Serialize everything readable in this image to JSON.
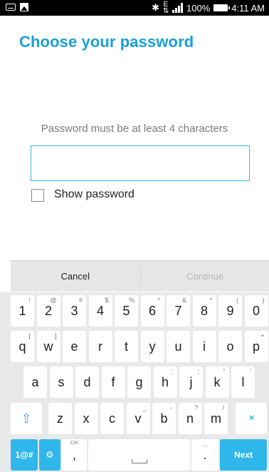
{
  "status_bar": {
    "network_type": "E",
    "battery_percent": "100%",
    "time": "4:11 AM"
  },
  "screen": {
    "title": "Choose your password",
    "hint": "Password must be at least 4 characters",
    "password_value": "",
    "show_password_label": "Show password",
    "show_password_checked": false
  },
  "actions": {
    "cancel": "Cancel",
    "continue": "Continue"
  },
  "keyboard": {
    "rows": [
      [
        {
          "label": "1",
          "secondary": "!"
        },
        {
          "label": "2",
          "secondary": "@"
        },
        {
          "label": "3",
          "secondary": "#"
        },
        {
          "label": "4",
          "secondary": "$"
        },
        {
          "label": "5",
          "secondary": "%"
        },
        {
          "label": "6",
          "secondary": "^"
        },
        {
          "label": "7",
          "secondary": "&"
        },
        {
          "label": "8",
          "secondary": "*"
        },
        {
          "label": "9",
          "secondary": "("
        },
        {
          "label": "0",
          "secondary": ")"
        }
      ],
      [
        {
          "label": "q",
          "secondary": "["
        },
        {
          "label": "w",
          "secondary": "]"
        },
        {
          "label": "e",
          "secondary": ""
        },
        {
          "label": "r",
          "secondary": ""
        },
        {
          "label": "t",
          "secondary": ""
        },
        {
          "label": "y",
          "secondary": ""
        },
        {
          "label": "u",
          "secondary": ""
        },
        {
          "label": "i",
          "secondary": ""
        },
        {
          "label": "o",
          "secondary": ""
        },
        {
          "label": "p",
          "secondary": "+"
        }
      ],
      [
        {
          "label": "a",
          "secondary": ""
        },
        {
          "label": "s",
          "secondary": ""
        },
        {
          "label": "d",
          "secondary": ""
        },
        {
          "label": "f",
          "secondary": ""
        },
        {
          "label": "g",
          "secondary": ""
        },
        {
          "label": "h",
          "secondary": ":"
        },
        {
          "label": "j",
          "secondary": ";"
        },
        {
          "label": "k",
          "secondary": "\""
        },
        {
          "label": "l",
          "secondary": "'"
        }
      ],
      [
        {
          "label": "z",
          "secondary": ""
        },
        {
          "label": "x",
          "secondary": ""
        },
        {
          "label": "c",
          "secondary": ""
        },
        {
          "label": "v",
          "secondary": "_"
        },
        {
          "label": "b",
          "secondary": "-"
        },
        {
          "label": "n",
          "secondary": "?"
        },
        {
          "label": "m",
          "secondary": "/"
        }
      ]
    ],
    "symbols_key": "1@#",
    "comma_key": ",",
    "comma_secondary": "Ctrl",
    "period_key": ".",
    "period_secondary": "…",
    "next_key": "Next"
  },
  "colors": {
    "accent": "#19a0d8",
    "input_border": "#33b5e5",
    "keyboard_bg": "#e8e9eb",
    "action_key": "#2fb6ea"
  }
}
